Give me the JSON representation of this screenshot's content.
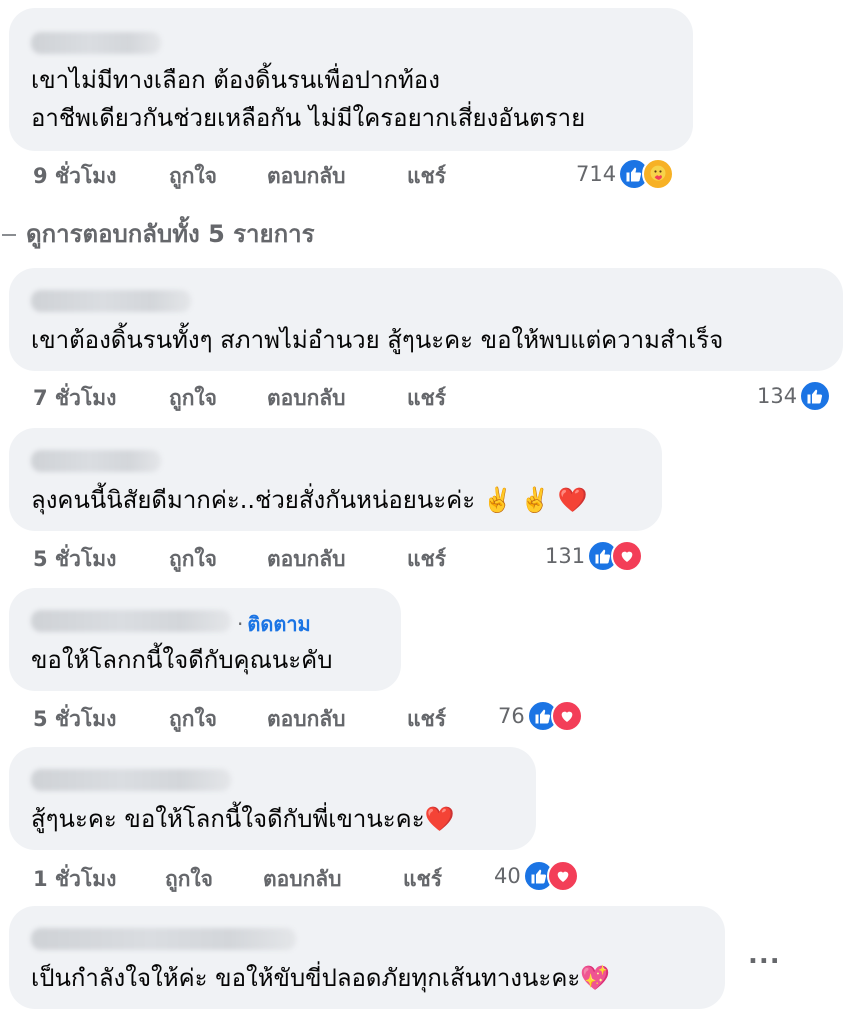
{
  "actions": {
    "like": "ถูกใจ",
    "reply": "ตอบกลับ",
    "share": "แชร์"
  },
  "view_replies": "ดูการตอบกลับทั้ง 5 รายการ",
  "follow_label": "ติดตาม",
  "more_label": "...",
  "comments": [
    {
      "lines": [
        "เขาไม่มีทางเลือก ต้องดิ้นรนเพื่อปากท้อง",
        "อาชีพเดียวกันช่วยเหลือกัน ไม่มีใครอยากเสี่ยงอันตราย"
      ],
      "time": "9 ชั่วโมง",
      "reaction_count": "714",
      "reactions": [
        "like",
        "care"
      ]
    },
    {
      "lines": [
        "เขาต้องดิ้นรนทั้งๆ สภาพไม่อำนวย สู้ๆนะคะ ขอให้พบแต่ความสำเร็จ"
      ],
      "time": "7 ชั่วโมง",
      "reaction_count": "134",
      "reactions": [
        "like"
      ]
    },
    {
      "lines": [
        "ลุงคนนี้นิสัยดีมากค่ะ..ช่วยสั่งกันหน่อยนะค่ะ ✌️ ✌️ ❤️"
      ],
      "time": "5 ชั่วโมง",
      "reaction_count": "131",
      "reactions": [
        "like",
        "love"
      ]
    },
    {
      "lines": [
        "ขอให้โลกกนี้ใจดีกับคุณนะคับ"
      ],
      "time": "5 ชั่วโมง",
      "reaction_count": "76",
      "reactions": [
        "like",
        "love"
      ]
    },
    {
      "lines": [
        "สู้ๆนะคะ ขอให้โลกนี้ใจดีกับพี่เขานะคะ❤️"
      ],
      "time": "1 ชั่วโมง",
      "reaction_count": "40",
      "reactions": [
        "like",
        "love"
      ]
    },
    {
      "lines": [
        "เป็นกำลังใจให้ค่ะ ขอให้ขับขี่ปลอดภัยทุกเส้นทางนะคะ💖"
      ]
    }
  ],
  "colors": {
    "bubble": "#f0f2f5",
    "meta_text": "#65676b",
    "link_blue": "#1b74e4",
    "like_blue": "#1b74e4",
    "love_red": "#f33e58",
    "care_yellow": "#f7b125"
  },
  "icons": {
    "like": "like-icon",
    "love": "love-icon",
    "care": "care-icon"
  }
}
